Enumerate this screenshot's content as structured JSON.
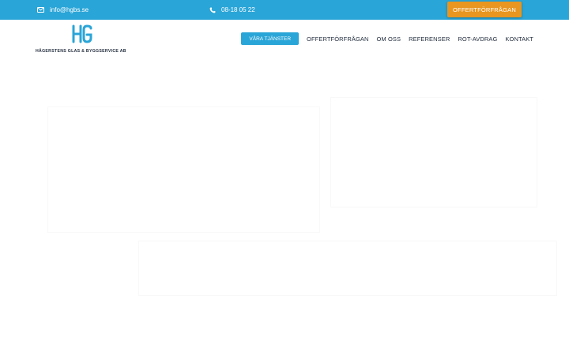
{
  "topbar": {
    "email": "info@hgbs.se",
    "phone": "08-18 05 22",
    "cta_label": "OFFERTFÖRFRÅGAN",
    "icons": {
      "email": "envelope-icon",
      "phone": "phone-icon"
    }
  },
  "header": {
    "logo_text": "HÄGERSTENS GLAS & BYGGSERVICE AB",
    "logo_icon": "hgbs-logo-icon",
    "nav": {
      "services_label": "VÅRA TJÄNSTER",
      "items": [
        "OFFERTFÖRFRÅGAN",
        "OM OSS",
        "REFERENSER",
        "ROT-AVDRAG",
        "KONTAKT"
      ]
    }
  },
  "colors": {
    "topbar": "#2aa5d7",
    "cta": "#e8961f",
    "nav_text": "#1f2a3a"
  }
}
